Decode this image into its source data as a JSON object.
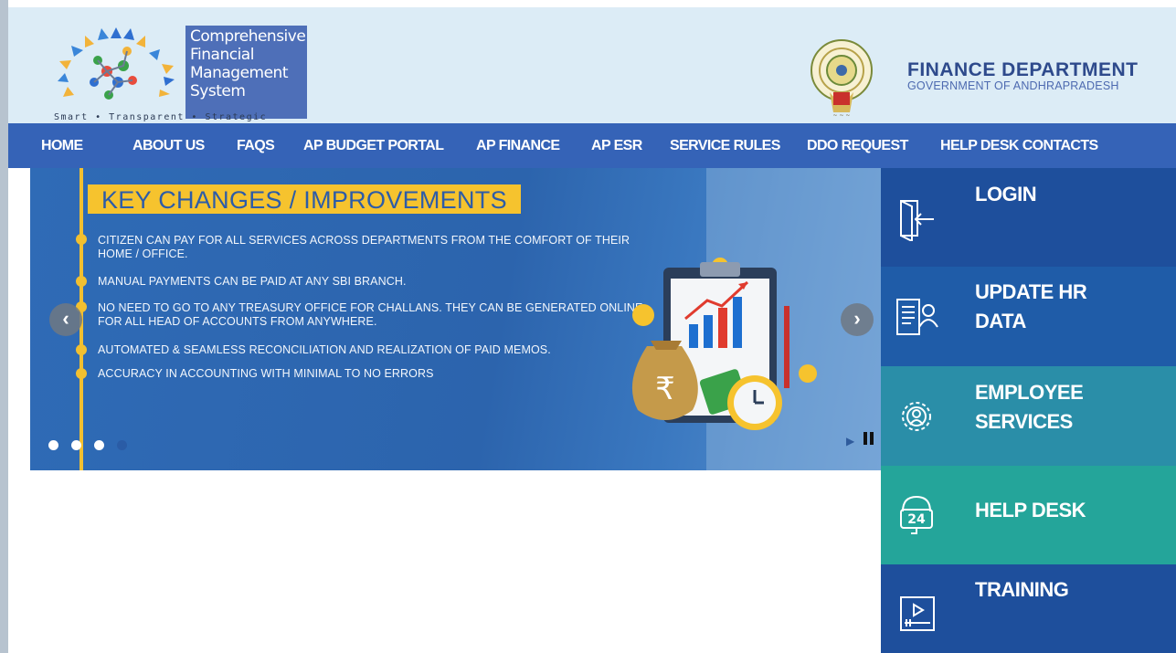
{
  "header": {
    "logo_lines": [
      "Comprehensive",
      "Financial",
      "Management",
      "System"
    ],
    "tagline": "Smart • Transparent • Strategic",
    "dept_title": "FINANCE DEPARTMENT",
    "dept_subtitle": "GOVERNMENT OF ANDHRAPRADESH"
  },
  "nav": {
    "items": [
      {
        "label": "HOME"
      },
      {
        "label": "ABOUT US"
      },
      {
        "label": "FAQS"
      },
      {
        "label": "AP BUDGET PORTAL"
      },
      {
        "label": "AP FINANCE"
      },
      {
        "label": "AP ESR"
      },
      {
        "label": "SERVICE RULES"
      },
      {
        "label": "DDO REQUEST"
      },
      {
        "label": "HELP DESK CONTACTS"
      }
    ]
  },
  "slider": {
    "title": "KEY CHANGES / IMPROVEMENTS",
    "bullets": [
      "CITIZEN CAN PAY FOR ALL SERVICES ACROSS DEPARTMENTS FROM THE COMFORT OF THEIR HOME / OFFICE.",
      "MANUAL PAYMENTS CAN BE PAID AT ANY SBI BRANCH.",
      "NO NEED TO GO TO ANY TREASURY OFFICE FOR CHALLANS. THEY CAN BE GENERATED ONLINE FOR ALL HEAD OF ACCOUNTS FROM ANYWHERE.",
      "AUTOMATED & SEAMLESS  RECONCILIATION AND REALIZATION OF PAID MEMOS.",
      "ACCURACY IN ACCOUNTING WITH MINIMAL TO NO ERRORS"
    ],
    "prev_glyph": "‹",
    "next_glyph": "›",
    "rupee": "₹",
    "play_glyph": "▶",
    "slide_count": 4,
    "active_slide": 4
  },
  "tiles": [
    {
      "line1": "LOGIN",
      "line2": "",
      "icon": "login-door-icon",
      "color": "#1e4f9c"
    },
    {
      "line1": "UPDATE HR",
      "line2": "DATA",
      "icon": "hr-data-icon",
      "color": "#1f5ca8"
    },
    {
      "line1": "EMPLOYEE",
      "line2": "SERVICES",
      "icon": "gear-person-icon",
      "color": "#2a8ea8"
    },
    {
      "line1": "HELP DESK",
      "line2": "",
      "icon": "24-hour-support-icon",
      "color": "#24a59a"
    },
    {
      "line1": "TRAINING",
      "line2": "",
      "icon": "video-player-icon",
      "color": "#1e4f9c"
    }
  ],
  "colors": {
    "nav": "#3563b7",
    "header_bg": "#dcecf6",
    "accent_yellow": "#f6c32e"
  }
}
